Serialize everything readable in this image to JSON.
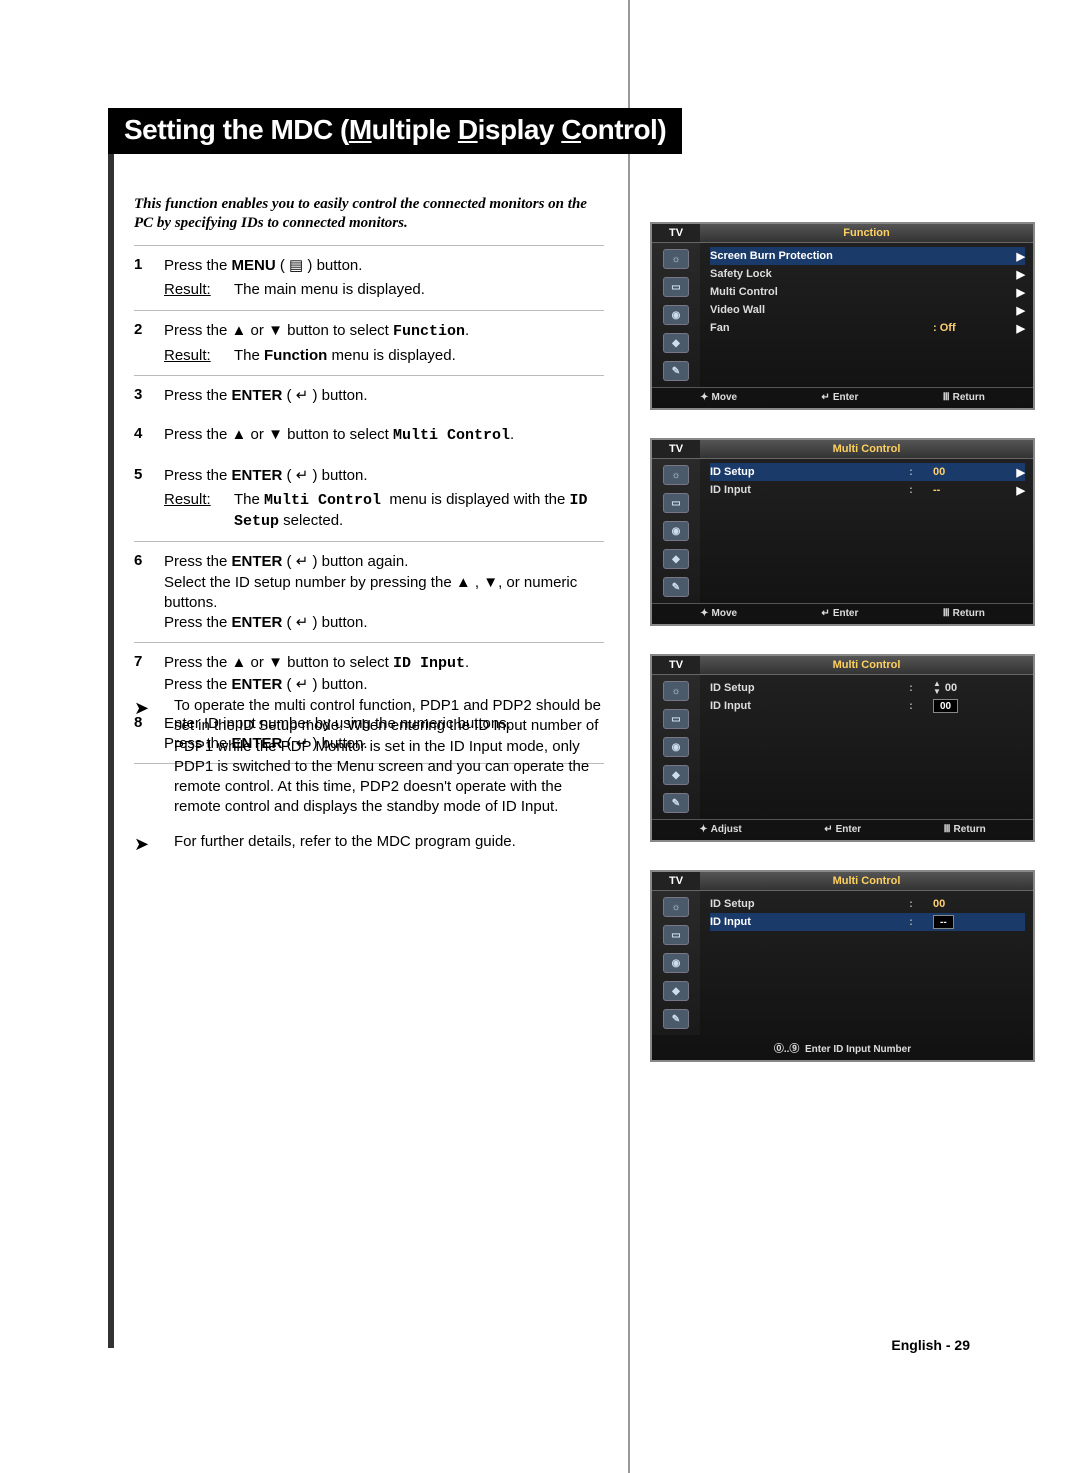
{
  "title_html": "Setting the MDC (<span class='u'>M</span>ultiple <span class='u'>D</span>isplay <span class='u'>C</span>ontrol)",
  "intro": "This function enables you to easily control the connected monitors on the PC by specifying IDs to connected monitors.",
  "steps": [
    {
      "n": "1",
      "body_html": "Press the <strong>MENU</strong> ( <span class='glyph'>&#9636;</span> ) button.",
      "result_html": "The main menu is displayed.",
      "hr_before": true
    },
    {
      "n": "2",
      "body_html": "Press the <span class='glyph'>▲</span> or <span class='glyph'>▼</span> button to select <span class='mono'>Function</span>.",
      "result_html": "The <strong>Function</strong> menu is displayed.",
      "hr_before": true
    },
    {
      "n": "3",
      "body_html": "Press the <strong>ENTER</strong> ( <span class='glyph'>↵</span> ) button.",
      "hr_before": true
    },
    {
      "n": "4",
      "body_html": "Press the <span class='glyph'>▲</span> or <span class='glyph'>▼</span> button to select <span class='mono'>Multi Control</span>.",
      "hr_before": false
    },
    {
      "n": "5",
      "body_html": "Press the <strong>ENTER</strong> ( <span class='glyph'>↵</span> ) button.",
      "result_html": "The <span class='mono'>Multi Control</span> &nbsp;menu is displayed with the <span class='mono'>ID Setup</span> selected.",
      "hr_before": false
    },
    {
      "n": "6",
      "body_html": "Press the <strong>ENTER</strong> ( <span class='glyph'>↵</span> ) button again.<br>Select the ID setup number by pressing the <span class='glyph'>▲</span> , <span class='glyph'>▼</span>, or numeric buttons.<br>Press the <strong>ENTER</strong> ( <span class='glyph'>↵</span> ) button.",
      "hr_before": true
    },
    {
      "n": "7",
      "body_html": "Press the <span class='glyph'>▲</span> or <span class='glyph'>▼</span> button to select <span class='mono'>ID Input</span>.<br>Press the <strong>ENTER</strong> ( <span class='glyph'>↵</span> ) button.",
      "hr_before": true
    },
    {
      "n": "8",
      "body_html": "Enter ID input number by using the numeric buttons.<br>Press the <strong>ENTER</strong> ( <span class='glyph'>↵</span> ) button.",
      "hr_before": false,
      "hr_after": true
    }
  ],
  "result_label": "Result:",
  "notes": [
    "To operate the multi control function, PDP1 and PDP2 should be set in the ID Setup mode. When entering the ID Input number of PDP1 while the PDP Monitor is set in the ID Input mode, only PDP1 is switched to the Menu screen and you can operate the remote control. At this time, PDP2 doesn't operate with the remote control and displays the standby mode of ID Input.",
    "For further details, refer to the MDC program guide."
  ],
  "footer": "English - 29",
  "osd": {
    "tv_label": "TV",
    "foot_move": "Move",
    "foot_adjust": "Adjust",
    "foot_enter": "Enter",
    "foot_return": "Return",
    "panel1": {
      "title": "Function",
      "rows": [
        {
          "label": "Screen Burn Protection",
          "arrow": "▶",
          "sel": true
        },
        {
          "label": "Safety Lock",
          "arrow": "▶"
        },
        {
          "label": "Multi Control",
          "arrow": "▶"
        },
        {
          "label": "Video Wall",
          "arrow": "▶"
        },
        {
          "label": "Fan",
          "value": ": Off",
          "arrow": "▶"
        }
      ]
    },
    "panel2": {
      "title": "Multi Control",
      "rows": [
        {
          "label": "ID Setup",
          "colon": ":",
          "value": "00",
          "arrow": "▶",
          "sel": true
        },
        {
          "label": "ID Input",
          "colon": ":",
          "value": "--",
          "arrow": "▶"
        }
      ]
    },
    "panel3": {
      "title": "Multi Control",
      "rows": [
        {
          "label": "ID Setup",
          "colon": ":",
          "spinner": "00"
        },
        {
          "label": "ID Input",
          "colon": ":",
          "boxed": "00"
        }
      ]
    },
    "panel4": {
      "title": "Multi Control",
      "rows": [
        {
          "label": "ID Setup",
          "colon": ":",
          "value": "00"
        },
        {
          "label": "ID Input",
          "colon": ":",
          "boxed": "--",
          "sel": true
        }
      ],
      "footer_text": "Enter ID Input Number"
    }
  }
}
